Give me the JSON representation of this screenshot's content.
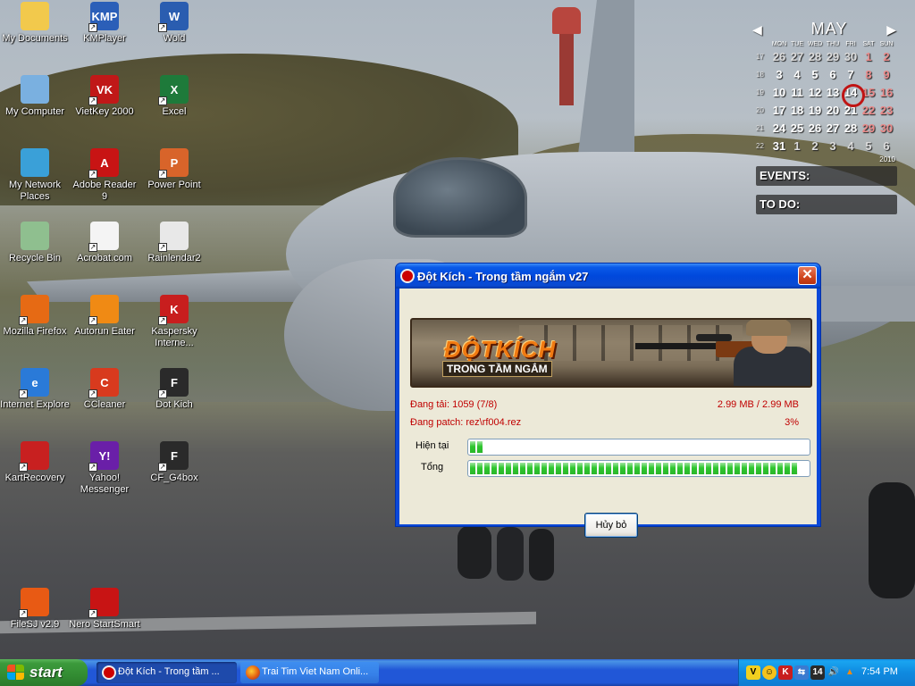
{
  "desktop": {
    "icons": [
      {
        "label": "My Documents",
        "icon": "folder-icon",
        "color": "#f2c94c",
        "glyph": "",
        "shortcut": false
      },
      {
        "label": "KMPlayer",
        "icon": "kmplayer-icon",
        "color": "#2b5fb8",
        "glyph": "KMP",
        "shortcut": true
      },
      {
        "label": "Wold",
        "icon": "word-icon",
        "color": "#2a5db0",
        "glyph": "W",
        "shortcut": true
      },
      {
        "label": "My Computer",
        "icon": "computer-icon",
        "color": "#7ab0e0",
        "glyph": "",
        "shortcut": false
      },
      {
        "label": "VietKey 2000",
        "icon": "vietkey-icon",
        "color": "#c01818",
        "glyph": "VK",
        "shortcut": true
      },
      {
        "label": "Excel",
        "icon": "excel-icon",
        "color": "#1e7a3a",
        "glyph": "X",
        "shortcut": true
      },
      {
        "label": "My Network Places",
        "icon": "network-icon",
        "color": "#3aa0d8",
        "glyph": "",
        "shortcut": false
      },
      {
        "label": "Adobe Reader 9",
        "icon": "adobe-reader-icon",
        "color": "#c81414",
        "glyph": "A",
        "shortcut": true
      },
      {
        "label": "Power Point",
        "icon": "powerpoint-icon",
        "color": "#d8642a",
        "glyph": "P",
        "shortcut": true
      },
      {
        "label": "Recycle Bin",
        "icon": "recycle-bin-icon",
        "color": "#8fbf8f",
        "glyph": "",
        "shortcut": false
      },
      {
        "label": "Acrobat.com",
        "icon": "acrobat-icon",
        "color": "#f4f4f4",
        "glyph": "",
        "shortcut": true
      },
      {
        "label": "Rainlendar2",
        "icon": "rainlendar-icon",
        "color": "#e8e8e8",
        "glyph": "",
        "shortcut": true
      },
      {
        "label": "Mozilla Firefox",
        "icon": "firefox-icon",
        "color": "#e66a14",
        "glyph": "",
        "shortcut": true
      },
      {
        "label": "Autorun Eater",
        "icon": "autorun-eater-icon",
        "color": "#f08a14",
        "glyph": "",
        "shortcut": true
      },
      {
        "label": "Kaspersky Interne...",
        "icon": "kaspersky-icon",
        "color": "#c81e1e",
        "glyph": "K",
        "shortcut": true
      },
      {
        "label": "Internet Explore",
        "icon": "ie-icon",
        "color": "#2a7ad8",
        "glyph": "e",
        "shortcut": true
      },
      {
        "label": "CCleaner",
        "icon": "ccleaner-icon",
        "color": "#d83a1e",
        "glyph": "C",
        "shortcut": true
      },
      {
        "label": "Dot Kich",
        "icon": "dotkich-icon",
        "color": "#2a2a2a",
        "glyph": "F",
        "shortcut": true
      },
      {
        "label": "KartRecovery",
        "icon": "kart-icon",
        "color": "#c82020",
        "glyph": "",
        "shortcut": true
      },
      {
        "label": "Yahoo! Messenger",
        "icon": "yahoo-icon",
        "color": "#6a1fa8",
        "glyph": "Y!",
        "shortcut": true
      },
      {
        "label": "CF_G4box",
        "icon": "cf-icon",
        "color": "#2a2a2a",
        "glyph": "F",
        "shortcut": true
      },
      {
        "label": "FileSJ v2.9",
        "icon": "filesj-icon",
        "color": "#e85a14",
        "glyph": "",
        "shortcut": true
      },
      {
        "label": "Nero StartSmart",
        "icon": "nero-icon",
        "color": "#c81414",
        "glyph": "",
        "shortcut": true
      }
    ]
  },
  "calendar": {
    "month": "MAY",
    "year": "2010",
    "dows": [
      "MON",
      "TUE",
      "WED",
      "THU",
      "FRI",
      "SAT",
      "SUN"
    ],
    "weeks": [
      {
        "wk": "17",
        "days": [
          "26",
          "27",
          "28",
          "29",
          "30",
          "1",
          "2"
        ]
      },
      {
        "wk": "18",
        "days": [
          "3",
          "4",
          "5",
          "6",
          "7",
          "8",
          "9"
        ]
      },
      {
        "wk": "19",
        "days": [
          "10",
          "11",
          "12",
          "13",
          "14",
          "15",
          "16"
        ]
      },
      {
        "wk": "20",
        "days": [
          "17",
          "18",
          "19",
          "20",
          "21",
          "22",
          "23"
        ]
      },
      {
        "wk": "21",
        "days": [
          "24",
          "25",
          "26",
          "27",
          "28",
          "29",
          "30"
        ]
      },
      {
        "wk": "22",
        "days": [
          "31",
          "1",
          "2",
          "3",
          "4",
          "5",
          "6"
        ]
      }
    ],
    "today": "14",
    "events_label": "EVENTS:",
    "todo_label": "TO DO:"
  },
  "dialog": {
    "title": "Đột Kích - Trong tầm ngắm v27",
    "banner_logo": "ĐỘTKÍCH",
    "banner_sub": "TRONG TẦM NGẮM",
    "downloading_label": "Đang tải: 1059 (7/8)",
    "downloading_size": "2.99 MB / 2.99 MB",
    "patching_label": "Đang patch: rez\\rf004.rez",
    "patching_percent": "3%",
    "current_label": "Hiện tại",
    "current_progress": 3,
    "total_label": "Tổng",
    "total_progress": 97,
    "cancel_label": "Hủy bỏ"
  },
  "taskbar": {
    "start_label": "start",
    "tasks": [
      {
        "label": "Đột Kích - Trong tầm ...",
        "icon": "dotkich-icon",
        "active": true
      },
      {
        "label": "Trai Tim Viet Nam Onli...",
        "icon": "firefox-icon",
        "active": false
      }
    ],
    "tray_icons": [
      "vietkey-tray-icon",
      "yahoo-tray-icon",
      "kaspersky-tray-icon",
      "network-tray-icon",
      "rainlendar-tray-icon",
      "volume-icon",
      "autorun-tray-icon"
    ],
    "tray_badge": "14",
    "clock": "7:54 PM"
  }
}
